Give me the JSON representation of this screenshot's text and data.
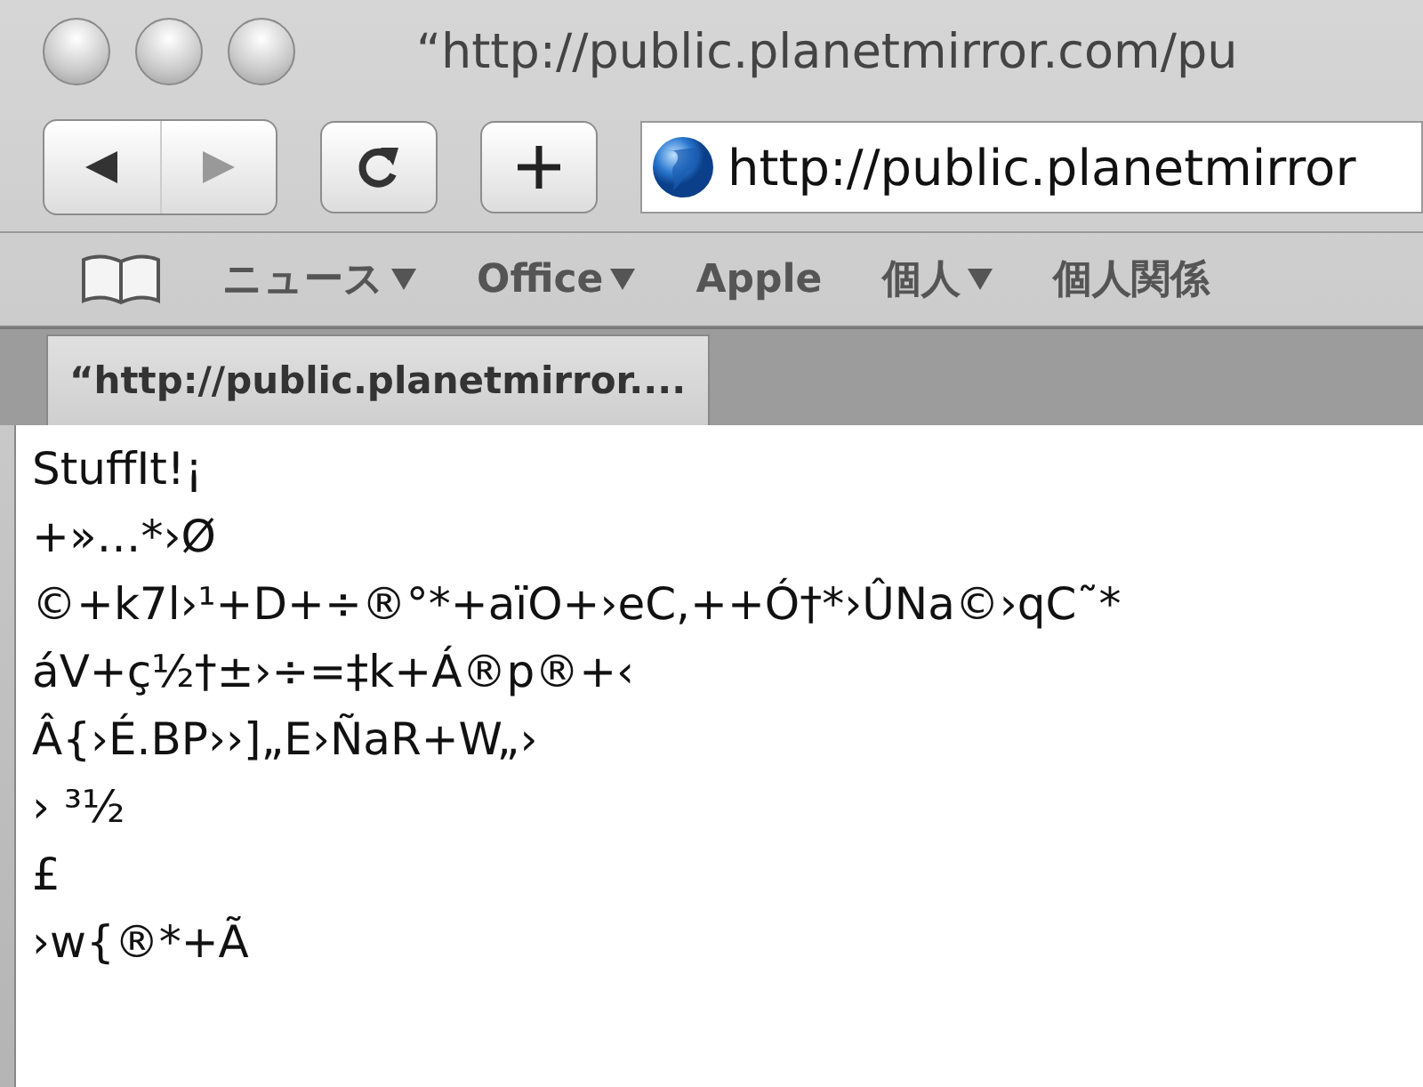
{
  "window": {
    "title": "“http://public.planetmirror.com/pu"
  },
  "toolbar": {
    "address": "http://public.planetmirror"
  },
  "bookmarks": [
    {
      "label": "ニュース",
      "menu": true
    },
    {
      "label": "Office",
      "menu": true
    },
    {
      "label": "Apple",
      "menu": false
    },
    {
      "label": "個人",
      "menu": true
    },
    {
      "label": "個人関係",
      "menu": false
    }
  ],
  "tabs": [
    {
      "label": "“http://public.planetmirror....",
      "selected": true
    }
  ],
  "content": {
    "lines": [
      "StuffIt!¡",
      "+»…*›Ø",
      "©+k7l›¹+D+÷®°*+aïO+›eC,++Ó†*›ÛNa©›qC˜*",
      "áV+ç½†±›÷=‡k+Á®p®+‹",
      "Â{›É.BP››]„E›ÑaR+W„›",
      "› ³½",
      "£",
      "›w{®*+Ã"
    ]
  }
}
